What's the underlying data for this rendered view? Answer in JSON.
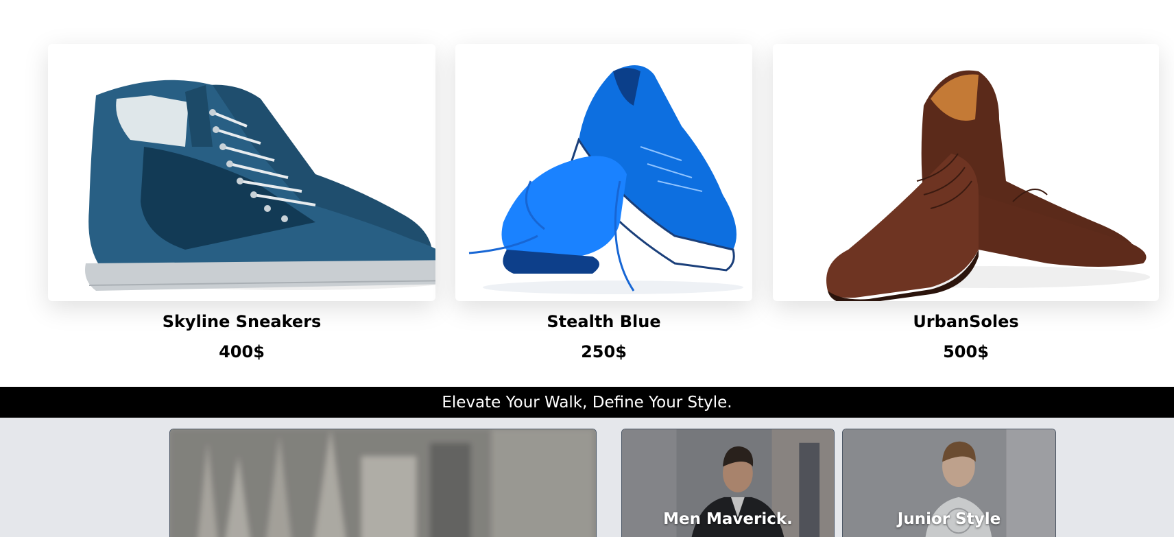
{
  "products": [
    {
      "name": "Skyline Sneakers",
      "price": "400$",
      "image": "blue-high-top-sneakers"
    },
    {
      "name": "Stealth Blue",
      "price": "250$",
      "image": "blue-running-shoes"
    },
    {
      "name": "UrbanSoles",
      "price": "500$",
      "image": "brown-oxford-shoes"
    }
  ],
  "banner": {
    "text": "Elevate Your Walk, Define Your Style."
  },
  "categories": [
    {
      "label": "",
      "image": "city-cathedral-blurred"
    },
    {
      "label": "Men Maverick.",
      "image": "man-in-suit"
    },
    {
      "label": "Junior Style",
      "image": "child-portrait"
    }
  ],
  "colors": {
    "banner_bg": "#000000",
    "section_bg": "#e5e7eb",
    "tile_border": "#4b5563"
  }
}
